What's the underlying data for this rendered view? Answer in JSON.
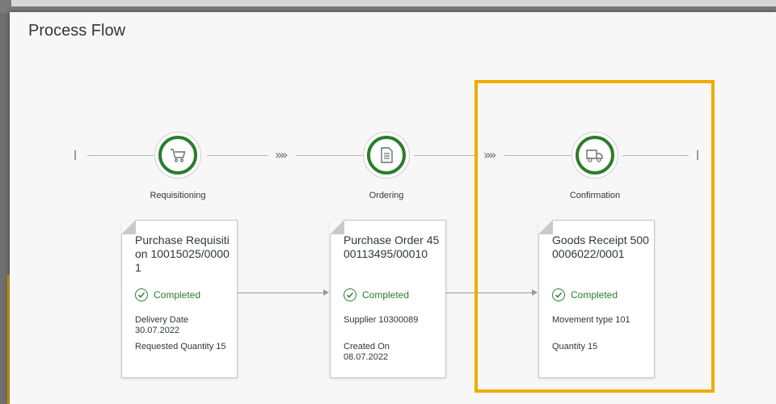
{
  "panel": {
    "title": "Process Flow"
  },
  "colors": {
    "accent": "#f0ab00",
    "success": "#2b7d2b",
    "text": "#32363a"
  },
  "lanes": [
    {
      "label": "Requisitioning",
      "icon": "shopping-cart-icon"
    },
    {
      "label": "Ordering",
      "icon": "document-list-icon"
    },
    {
      "label": "Confirmation",
      "icon": "delivery-truck-icon"
    }
  ],
  "chevron_glyph": "»»",
  "cards": [
    {
      "title": "Purchase Requisition 10015025/00001",
      "status": "Completed",
      "line1": "Delivery Date 30.07.2022",
      "line2": "Requested Quantity 15"
    },
    {
      "title": "Purchase Order 4500113495/00010",
      "status": "Completed",
      "line1": "Supplier 10300089",
      "line2": "Created On 08.07.2022"
    },
    {
      "title": "Goods Receipt 5000006022/0001",
      "status": "Completed",
      "line1": "Movement type 101",
      "line2": "Quantity 15"
    }
  ]
}
